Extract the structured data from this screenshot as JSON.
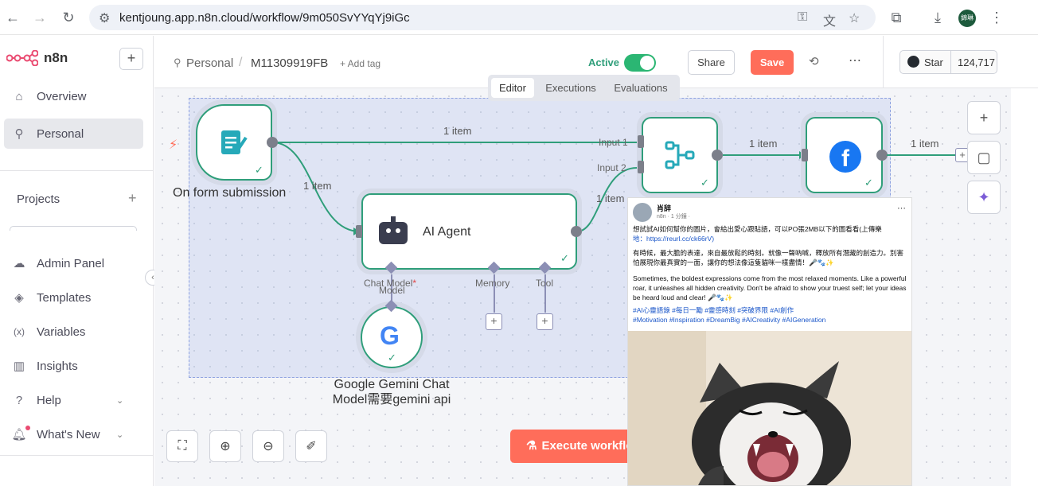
{
  "browser": {
    "url": "kentjoung.app.n8n.cloud/workflow/9m050SvYYqYj9iGc",
    "profile_initials": "錦琳"
  },
  "sidebar": {
    "brand": "n8n",
    "items": [
      {
        "label": "Overview",
        "icon": "home-icon"
      },
      {
        "label": "Personal",
        "icon": "user-icon"
      }
    ],
    "projects_label": "Projects",
    "bottom_items": [
      {
        "label": "Admin Panel",
        "icon": "cloud-icon"
      },
      {
        "label": "Templates",
        "icon": "layers-icon"
      },
      {
        "label": "Variables",
        "icon": "variable-icon"
      },
      {
        "label": "Insights",
        "icon": "chart-icon"
      },
      {
        "label": "Help",
        "icon": "help-icon"
      },
      {
        "label": "What's New",
        "icon": "bell-icon"
      }
    ]
  },
  "header": {
    "breadcrumb_project": "Personal",
    "workflow_name": "M11309919FB",
    "add_tag": "+ Add tag",
    "active_label": "Active",
    "share_label": "Share",
    "save_label": "Save",
    "star_label": "Star",
    "star_count": "124,717",
    "tabs": [
      "Editor",
      "Executions",
      "Evaluations"
    ]
  },
  "canvas": {
    "nodes": {
      "form_trigger": "On form submission",
      "ai_agent": "AI Agent",
      "gemini": "Google Gemini Chat Model需要gemini api",
      "merge": "",
      "facebook": ""
    },
    "edge_labels": [
      "1 item",
      "1 item",
      "1 item",
      "1 item",
      "1 item",
      "1 item"
    ],
    "inputs": [
      "Input 1",
      "Input 2"
    ],
    "agent_ports": {
      "chat_model": "Chat Model",
      "required_marker": "*",
      "memory": "Memory",
      "tool": "Tool"
    },
    "gemini_port": "Model",
    "execute_label": "Execute workflo"
  },
  "post": {
    "author": "肖辞",
    "meta": "n8n · 1 分鐘 ·",
    "line1": "想試試AI如何幫你的圖片，會給出愛心跟貼語，可以PO張2MB以下的圖看看(上傳樂",
    "line1b": "地：https://reurl.cc/ck66rV)",
    "zh_body": "有時候，最大膽的表達，來自最放鬆的時刻。就像一聲吶喊，釋放所有潛藏的創造力。別害怕展現你最真實的一面，讓你的想法像這隻貓咪一樣盡情！🎤🐾✨",
    "en_body": "Sometimes, the boldest expressions come from the most relaxed moments. Like a powerful roar, it unleashes all hidden creativity. Don't be afraid to show your truest self; let your ideas be heard loud and clear! 🎤🐾✨",
    "tags_zh": "#AI心靈語錄 #每日一勵 #靈感時刻 #突破界限 #AI創作",
    "tags_en": "#Motivation #Inspiration #DreamBig #AICreativity #AIGeneration"
  },
  "colors": {
    "accent_green": "#2f9e7a",
    "save_red": "#ff6d5a",
    "selection_blue": "#a9b8e8"
  }
}
